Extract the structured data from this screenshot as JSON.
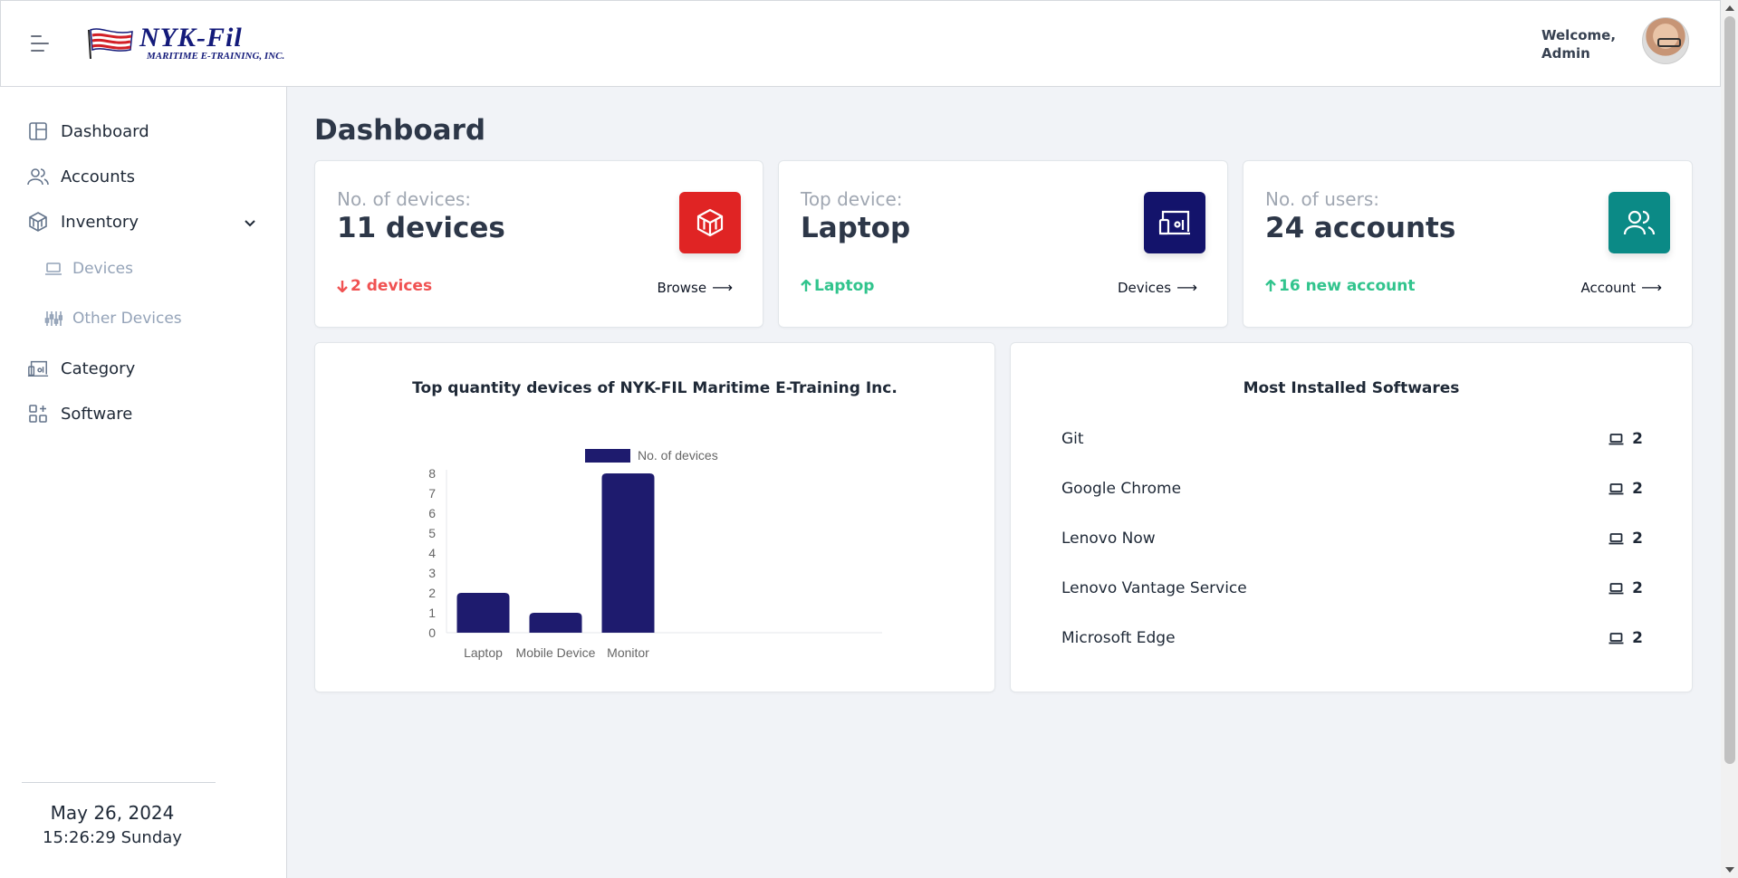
{
  "header": {
    "logo_main": "NYK-Fil",
    "logo_sub": "MARITIME E-TRAINING, INC.",
    "welcome_line1": "Welcome,",
    "welcome_line2": "Admin"
  },
  "sidebar": {
    "items": [
      {
        "label": "Dashboard",
        "icon": "layout-icon"
      },
      {
        "label": "Accounts",
        "icon": "users-icon"
      },
      {
        "label": "Inventory",
        "icon": "box-icon"
      },
      {
        "label": "Devices",
        "icon": "laptop-icon"
      },
      {
        "label": "Other Devices",
        "icon": "sliders-icon"
      },
      {
        "label": "Category",
        "icon": "devices-icon"
      },
      {
        "label": "Software",
        "icon": "grid-plus-icon"
      }
    ],
    "date": "May 26, 2024",
    "time": "15:26:29 Sunday"
  },
  "main": {
    "title": "Dashboard",
    "stats": [
      {
        "label": "No. of devices:",
        "value": "11 devices",
        "change": "2 devices",
        "change_dir": "down",
        "link": "Browse",
        "color": "#e02424"
      },
      {
        "label": "Top device:",
        "value": "Laptop",
        "change": "Laptop",
        "change_dir": "up",
        "link": "Devices",
        "color": "#13136b"
      },
      {
        "label": "No. of users:",
        "value": "24 accounts",
        "change": "16 new account",
        "change_dir": "up",
        "link": "Account",
        "color": "#0b8a86"
      }
    ],
    "software": {
      "title": "Most Installed Softwares",
      "rows": [
        {
          "name": "Git",
          "count": "2"
        },
        {
          "name": "Google Chrome",
          "count": "2"
        },
        {
          "name": "Lenovo Now",
          "count": "2"
        },
        {
          "name": "Lenovo Vantage Service",
          "count": "2"
        },
        {
          "name": "Microsoft Edge",
          "count": "2"
        }
      ]
    }
  },
  "colors": {
    "down": "#f05252",
    "up": "#31c48d",
    "bar": "#1e1b6e"
  },
  "chart_data": {
    "type": "bar",
    "title": "Top quantity devices of NYK-FIL Maritime E-Training Inc.",
    "categories": [
      "Laptop",
      "Mobile Device",
      "Monitor"
    ],
    "series": [
      {
        "name": "No. of devices",
        "values": [
          2,
          1,
          8
        ]
      }
    ],
    "xlabel": "",
    "ylabel": "",
    "ylim": [
      0,
      8
    ],
    "yticks": [
      0,
      1,
      2,
      3,
      4,
      5,
      6,
      7,
      8
    ],
    "legend": "top",
    "grid": false
  }
}
